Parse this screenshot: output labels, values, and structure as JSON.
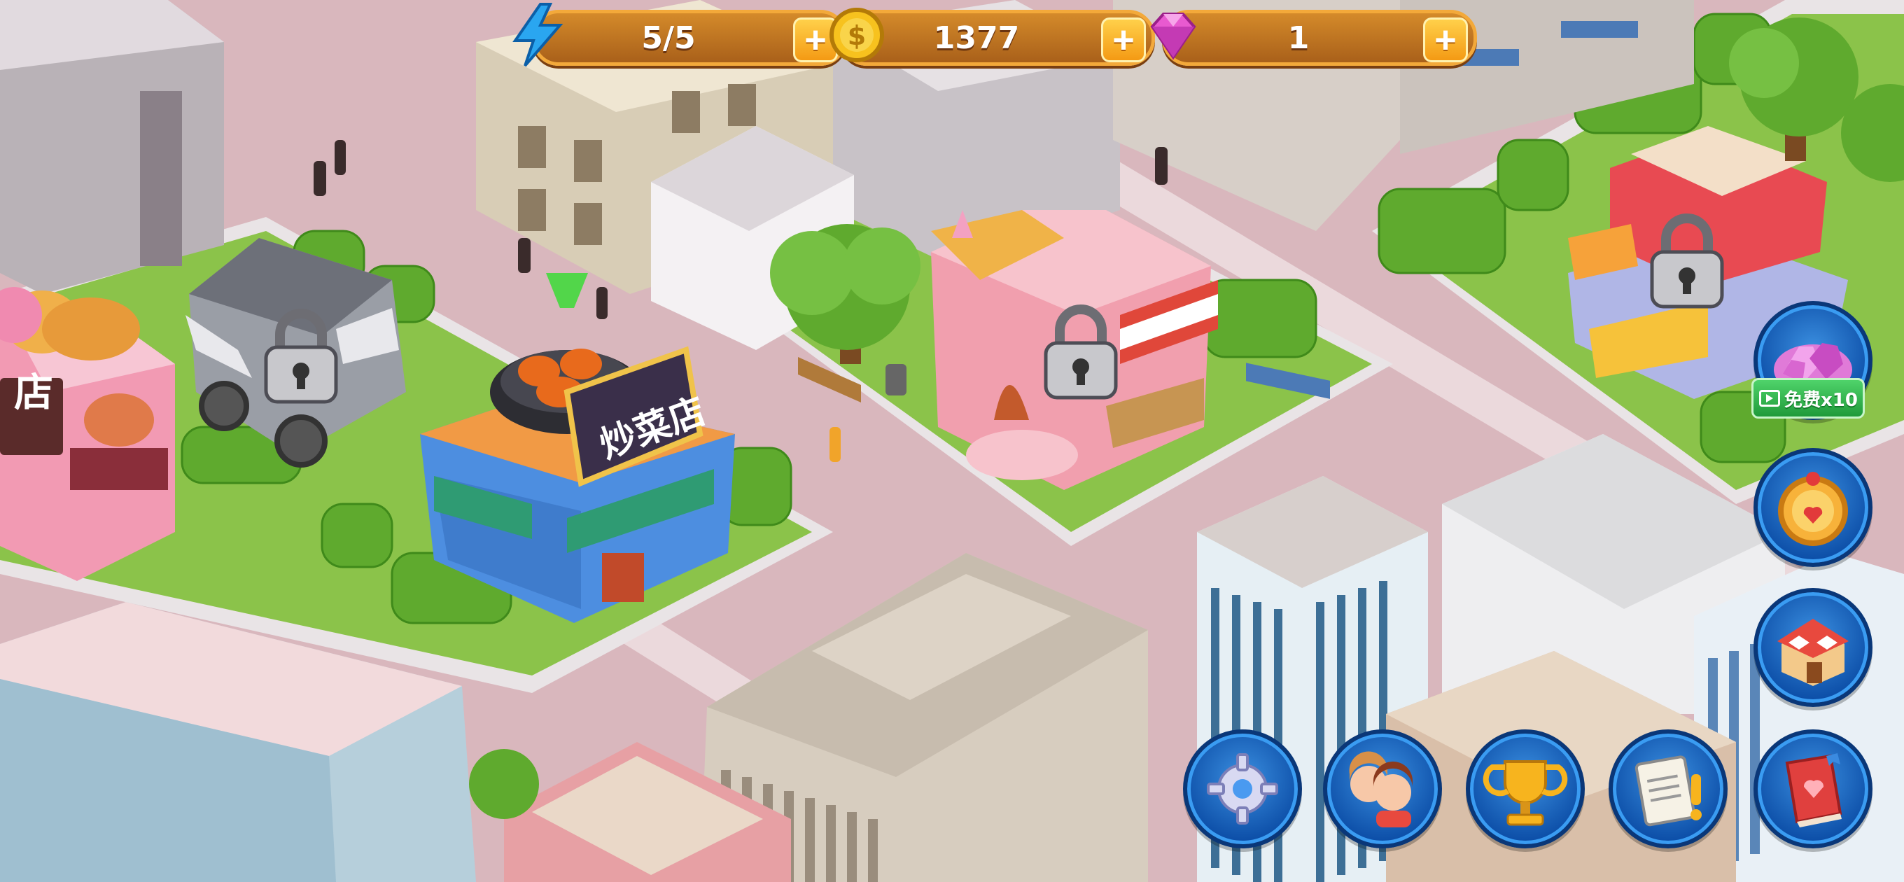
{
  "hud": {
    "energy": {
      "icon": "lightning-icon",
      "value": "5/5"
    },
    "coins": {
      "icon": "coin-icon",
      "value": "1377"
    },
    "gems": {
      "icon": "gem-icon",
      "value": "1"
    }
  },
  "map": {
    "stir_fry_shop_sign": "炒菜店",
    "bakery_sign_partial": "店",
    "locked_buildings": [
      "food-cart",
      "pink-restaurant",
      "candy-stall"
    ]
  },
  "side_buttons": {
    "gem_offer": {
      "icon": "gem-pile-icon",
      "label": "免费x10",
      "video_icon": "video-icon"
    },
    "lucky_wheel": {
      "icon": "wheel-icon"
    },
    "shop": {
      "icon": "shop-icon"
    }
  },
  "bottom_buttons": [
    {
      "name": "settings",
      "icon": "gear-icon"
    },
    {
      "name": "friends",
      "icon": "friends-icon"
    },
    {
      "name": "trophy",
      "icon": "trophy-icon"
    },
    {
      "name": "tasks",
      "icon": "notepad-icon"
    },
    {
      "name": "recipes",
      "icon": "book-icon"
    }
  ],
  "colors": {
    "road": "#d9b7bd",
    "grass": "#8bc34a",
    "hud_bar": "#c27a24",
    "hud_plus": "#f6a21a",
    "button_blue": "#1262c4"
  }
}
